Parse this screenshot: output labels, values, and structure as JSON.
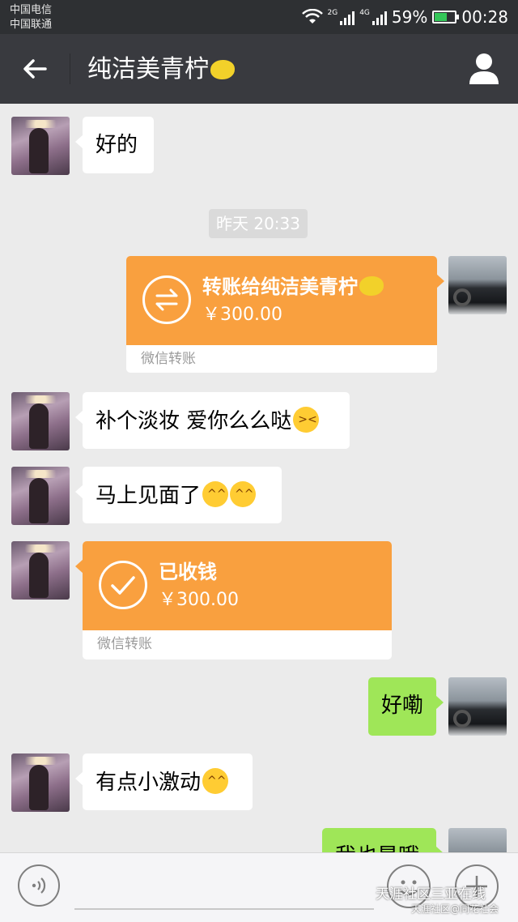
{
  "status_bar": {
    "carrier_1": "中国电信",
    "carrier_2": "中国联通",
    "signal_1_label": "2G",
    "signal_2_label": "4G",
    "battery": "59%",
    "battery_level": 0.59,
    "time": "00:28"
  },
  "header": {
    "title": "纯洁美青柠",
    "title_emoji": "lemon"
  },
  "messages": [
    {
      "side": "in",
      "type": "text",
      "text": "好的"
    },
    {
      "type": "timestamp",
      "text": "昨天 20:33"
    },
    {
      "side": "out",
      "type": "transfer",
      "title": "转账给纯洁美青柠",
      "amount": "￥300.00",
      "footer": "微信转账"
    },
    {
      "side": "in",
      "type": "text",
      "text": "补个淡妆 爱你么么哒"
    },
    {
      "side": "in",
      "type": "text",
      "text": "马上见面了"
    },
    {
      "side": "in",
      "type": "transfer",
      "title": "已收钱",
      "amount": "￥300.00",
      "footer": "微信转账"
    },
    {
      "side": "out",
      "type": "text",
      "text": "好嘞"
    },
    {
      "side": "in",
      "type": "text",
      "text": "有点小激动"
    },
    {
      "side": "out",
      "type": "text",
      "text": "我也是哦"
    }
  ],
  "watermark": {
    "line_1": "天涯社区三亚在线",
    "line_2": "天涯社区@同花社会"
  },
  "colors": {
    "nav_bg": "#393a3f",
    "chat_bg": "#ebebeb",
    "out_bubble": "#9fe658",
    "transfer": "#f9a03f"
  }
}
